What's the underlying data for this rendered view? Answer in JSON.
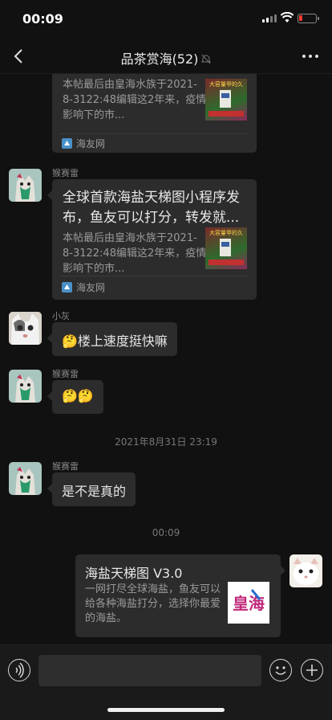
{
  "status_bar": {
    "time": "00:09"
  },
  "header": {
    "title": "品茶赏海(52)",
    "back_icon": "chevron-left-icon",
    "mute_icon": "bell-slash-icon",
    "more_icon": "ellipsis-icon"
  },
  "messages": [
    {
      "type": "link_card",
      "side": "left",
      "desc": "本帖最后由皇海水族于2021-8-3122:48编辑这2年来，疫情影响下的市...",
      "source": "海友网",
      "thumb_text": "大容量甲的久"
    },
    {
      "type": "link_card",
      "side": "left",
      "sender": "猴赛雷",
      "title": "全球首款海盐天梯图小程序发布，鱼友可以打分，转发就...",
      "desc": "本帖最后由皇海水族于2021-8-3122:48编辑这2年来，疫情影响下的市...",
      "source": "海友网",
      "thumb_text": "大容量甲的久"
    },
    {
      "type": "text",
      "side": "left",
      "sender": "小灰",
      "text": "🤔楼上速度挺快嘛"
    },
    {
      "type": "text",
      "side": "left",
      "sender": "猴赛雷",
      "text": "🤔🤔"
    },
    {
      "type": "timestamp",
      "text": "2021年8月31日 23:19"
    },
    {
      "type": "text",
      "side": "left",
      "sender": "猴赛雷",
      "text": "是不是真的"
    },
    {
      "type": "timestamp",
      "text": "00:09"
    },
    {
      "type": "mini_program",
      "side": "right",
      "title": "海盐天梯图 V3.0",
      "desc": "一网打尽全球海盐，鱼友可以给各种海盐打分，选择你最爱的海盐。",
      "thumb_text": "皇海"
    }
  ],
  "input_bar": {
    "voice_icon": "voice-icon",
    "emoji_icon": "emoji-icon",
    "plus_icon": "plus-icon"
  },
  "colors": {
    "background": "#111111",
    "bubble": "#2c2c2c",
    "battery_low": "#ff3b30"
  }
}
